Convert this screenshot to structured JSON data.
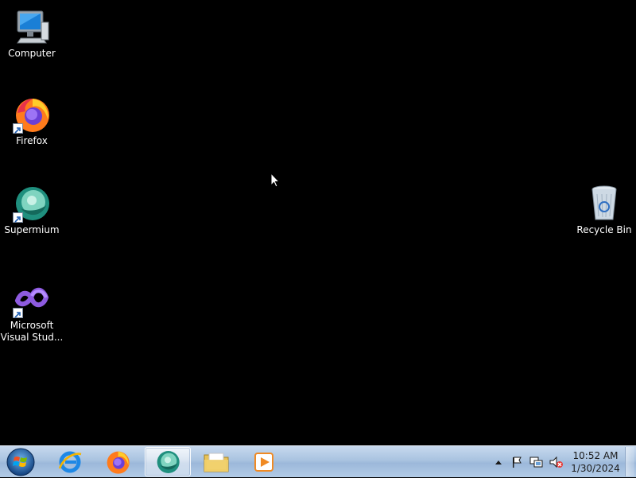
{
  "desktop": {
    "icons": [
      {
        "label": "Computer",
        "icon": "computer-icon",
        "shortcut": false
      },
      {
        "label": "Firefox",
        "icon": "firefox-icon",
        "shortcut": true
      },
      {
        "label": "Supermium",
        "icon": "supermium-icon",
        "shortcut": true
      },
      {
        "label": "Microsoft\nVisual Stud...",
        "icon": "visual-studio-icon",
        "shortcut": true
      },
      {
        "label": "Recycle Bin",
        "icon": "recycle-bin-icon",
        "shortcut": false
      }
    ]
  },
  "taskbar": {
    "start": {
      "icon": "windows-start-orb-icon"
    },
    "pinned": [
      {
        "icon": "internet-explorer-icon",
        "active": false
      },
      {
        "icon": "firefox-icon",
        "active": false
      },
      {
        "icon": "supermium-icon",
        "active": true
      },
      {
        "icon": "file-explorer-icon",
        "active": false
      },
      {
        "icon": "media-player-icon",
        "active": false
      }
    ],
    "tray": {
      "icons": [
        "show-hidden-icons-chevron",
        "action-center-flag-icon",
        "network-icon",
        "volume-muted-icon"
      ],
      "time": "10:52 AM",
      "date": "1/30/2024"
    }
  },
  "colors": {
    "desktop_background": "#000000",
    "taskbar_top": "#c7d9ee",
    "taskbar_bottom": "#9cb8da"
  }
}
